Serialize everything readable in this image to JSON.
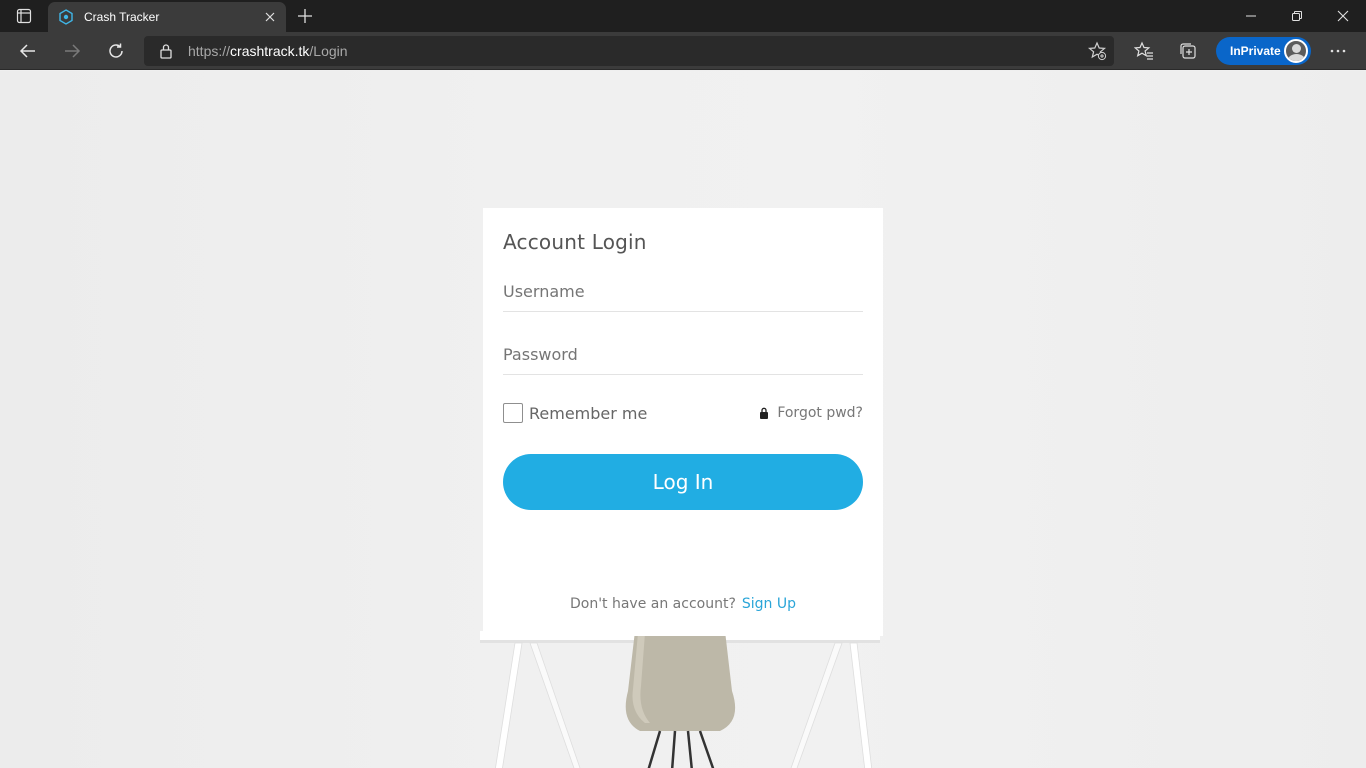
{
  "browser": {
    "tab_title": "Crash Tracker",
    "url_scheme": "https://",
    "url_host": "crashtrack.tk",
    "url_path": "/Login",
    "inprivate_label": "InPrivate",
    "colors": {
      "titlebar": "#1f1f1f",
      "toolbar": "#3b3b3b",
      "inprivate": "#0a66c9"
    },
    "icons": [
      "tab-actions-icon",
      "favicon-icon",
      "close-icon",
      "plus-icon",
      "minimize-icon",
      "restore-icon",
      "window-close-icon",
      "back-arrow-icon",
      "forward-arrow-icon",
      "refresh-icon",
      "lock-icon",
      "favorite-add-icon",
      "favorites-icon",
      "collections-icon",
      "more-icon"
    ]
  },
  "login": {
    "title": "Account Login",
    "username_placeholder": "Username",
    "password_placeholder": "Password",
    "remember_label": "Remember me",
    "forgot_label": "Forgot pwd?",
    "login_button": "Log In",
    "signup_prompt": "Don't have an account?",
    "signup_link": "Sign Up",
    "colors": {
      "button": "#21ade3",
      "link": "#2aa5d8"
    }
  }
}
